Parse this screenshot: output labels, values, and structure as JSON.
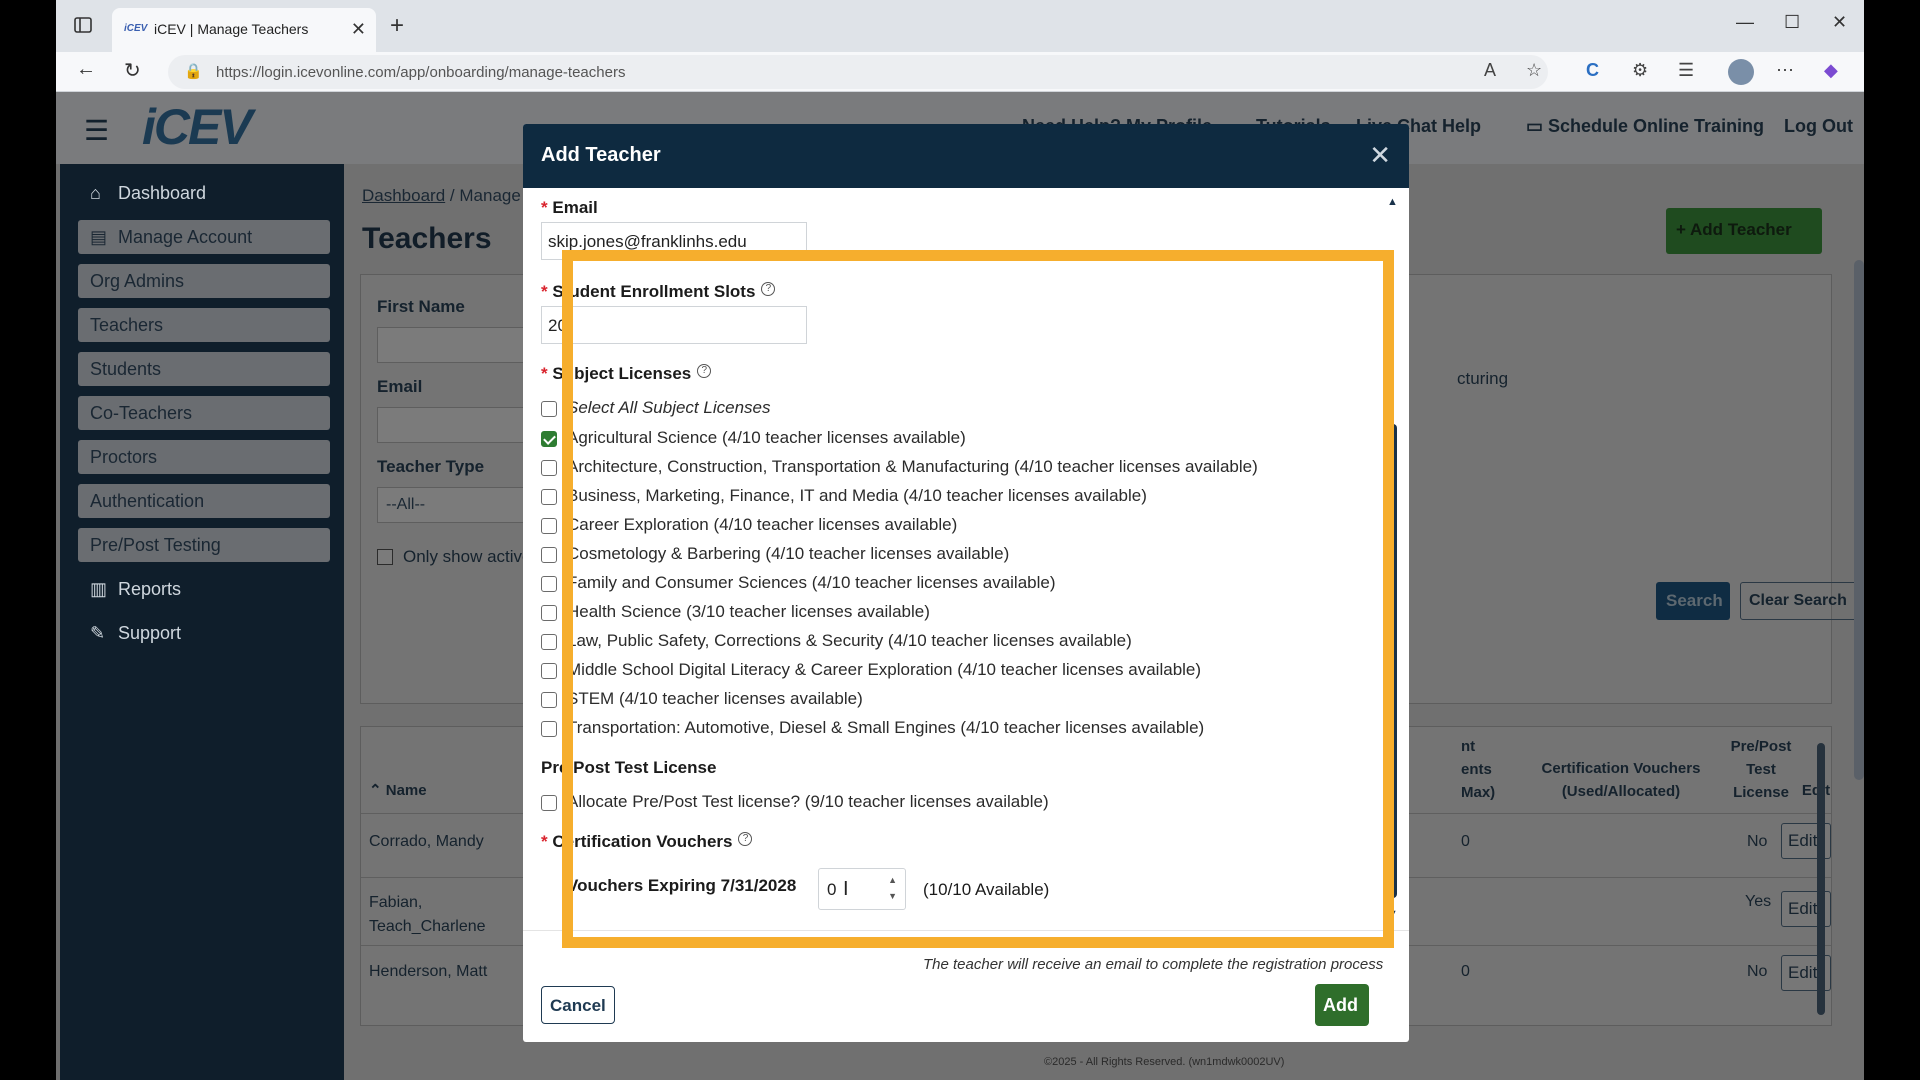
{
  "browser": {
    "tab_title": "iCEV | Manage Teachers",
    "tab_favicon": "iCEV",
    "url_host": "https://login.icevonline.com",
    "url_path": "/app/onboarding/manage-teachers"
  },
  "header": {
    "logo": "iCEV",
    "links": {
      "help_partial": "Need Help?",
      "profile_partial": "My Profile",
      "tutorials_partial": "Tutorials",
      "chat": "Live Chat Help",
      "schedule": "Schedule Online Training",
      "logout": "Log Out"
    }
  },
  "sidebar": {
    "items": [
      {
        "label": "Dashboard",
        "icon": "home-icon"
      },
      {
        "label": "Manage Account",
        "icon": "account-icon"
      },
      {
        "label": "Org Admins"
      },
      {
        "label": "Teachers"
      },
      {
        "label": "Students"
      },
      {
        "label": "Co-Teachers"
      },
      {
        "label": "Proctors"
      },
      {
        "label": "Authentication"
      },
      {
        "label": "Pre/Post Testing"
      },
      {
        "label": "Reports",
        "icon": "chart-icon"
      },
      {
        "label": "Support",
        "icon": "wrench-icon"
      }
    ]
  },
  "page": {
    "crumb_dashboard": "Dashboard",
    "crumb_sep": "/",
    "crumb_current": "Manage Teachers",
    "title": "Teachers",
    "add_teacher": "+ Add Teacher",
    "filters": {
      "first_name": "First Name",
      "email": "Email",
      "teacher_type": "Teacher Type",
      "teacher_type_value": "--All--",
      "only_show": "Only show active",
      "behind_text": "cturing"
    },
    "search": "Search",
    "clear_search": "Clear Search",
    "table": {
      "col_name": "Name",
      "col_students": "nt\nents\nMax)",
      "col_vouchers": "Certification Vouchers\n(Used/Allocated)",
      "col_prepost": "Pre/Post\nTest\nLicense",
      "col_edit": "Edit",
      "rows": [
        {
          "name": "Corrado, Mandy",
          "students": "0",
          "prepost": "No",
          "edit": "Edit"
        },
        {
          "name": "Fabian,\nTeach_Charlene",
          "students": "",
          "prepost": "Yes",
          "edit": "Edit"
        },
        {
          "name": "Henderson, Matt",
          "students": "0",
          "prepost": "No",
          "edit": "Edit"
        }
      ]
    },
    "footer": "©2025 - All Rights Reserved. (wn1mdwk0002UV)"
  },
  "modal": {
    "title": "Add Teacher",
    "required_mark": "*",
    "email_label": "Email",
    "email_value": "skip.jones@franklinhs.edu",
    "slots_label": "Student Enrollment Slots",
    "slots_value": "20",
    "subjects_label": "Subject Licenses",
    "select_all": "Select All Subject Licenses",
    "subjects": [
      {
        "label": "Agricultural Science (4/10 teacher licenses available)",
        "checked": true
      },
      {
        "label": "Architecture, Construction, Transportation & Manufacturing (4/10 teacher licenses available)",
        "checked": false
      },
      {
        "label": "Business, Marketing, Finance, IT and Media (4/10 teacher licenses available)",
        "checked": false
      },
      {
        "label": "Career Exploration (4/10 teacher licenses available)",
        "checked": false
      },
      {
        "label": "Cosmetology & Barbering (4/10 teacher licenses available)",
        "checked": false
      },
      {
        "label": "Family and Consumer Sciences (4/10 teacher licenses available)",
        "checked": false
      },
      {
        "label": "Health Science (3/10 teacher licenses available)",
        "checked": false
      },
      {
        "label": "Law, Public Safety, Corrections & Security (4/10 teacher licenses available)",
        "checked": false
      },
      {
        "label": "Middle School Digital Literacy & Career Exploration (4/10 teacher licenses available)",
        "checked": false
      },
      {
        "label": "STEM (4/10 teacher licenses available)",
        "checked": false
      },
      {
        "label": "Transportation: Automotive, Diesel & Small Engines (4/10 teacher licenses available)",
        "checked": false
      }
    ],
    "prepost_label": "Pre/Post Test License",
    "prepost_option": "Allocate Pre/Post Test license? (9/10 teacher licenses available)",
    "vouchers_label": "Certification Vouchers",
    "vouchers_expiring": "Vouchers Expiring 7/31/2028",
    "vouchers_value": "0",
    "vouchers_available": "(10/10 Available)",
    "footer_note": "The teacher will receive an email to complete the registration process",
    "cancel": "Cancel",
    "add": "Add"
  },
  "colors": {
    "highlight": "#f6ae2d",
    "header_navy": "#0e2a40",
    "add_green": "#2f6e2b"
  }
}
